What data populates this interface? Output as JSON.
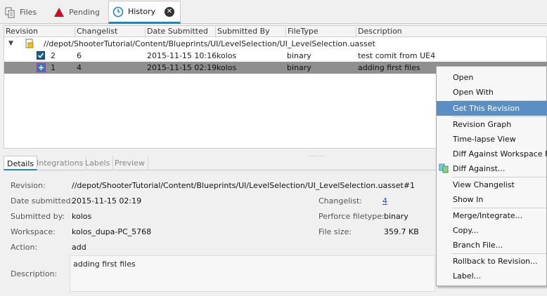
{
  "tabs": {
    "files": "Files",
    "pending": "Pending",
    "history": "History"
  },
  "grid": {
    "columns": [
      "Revision",
      "Changelist",
      "Date Submitted",
      "Submitted By",
      "FileType",
      "Description"
    ],
    "file_path": "//depot/ShooterTutorial/Content/Blueprints/UI/LevelSelection/UI_LevelSelection.uasset",
    "rows": [
      {
        "revision": "2",
        "changelist": "6",
        "date": "2015-11-15 10:16",
        "user": "kolos",
        "filetype": "binary",
        "description": "test comit from UE4"
      },
      {
        "revision": "1",
        "changelist": "4",
        "date": "2015-11-15 02:19",
        "user": "kolos",
        "filetype": "binary",
        "description": "adding first files"
      }
    ]
  },
  "lower_tabs": [
    "Details",
    "Integrations",
    "Labels",
    "Preview"
  ],
  "details": {
    "revision_label": "Revision:",
    "revision_value": "//depot/ShooterTutorial/Content/Blueprints/UI/LevelSelection/UI_LevelSelection.uasset#1",
    "date_label": "Date submitted:",
    "date_value": "2015-11-15 02:19",
    "submitted_label": "Submitted by:",
    "submitted_value": "kolos",
    "workspace_label": "Workspace:",
    "workspace_value": "kolos_dupa-PC_5768",
    "action_label": "Action:",
    "action_value": "add",
    "description_label": "Description:",
    "description_value": "adding first files",
    "changelist_label": "Changelist:",
    "changelist_value": "4",
    "filetype_label": "Perforce filetype:",
    "filetype_value": "binary",
    "filesize_label": "File size:",
    "filesize_value": "359.7 KB"
  },
  "context_menu": {
    "open": "Open",
    "open_with": "Open With",
    "get_revision": "Get This Revision",
    "revision_graph": "Revision Graph",
    "timelapse": "Time-lapse View",
    "diff_workspace": "Diff Against Workspace File",
    "diff_against": "Diff Against...",
    "view_changelist": "View Changelist",
    "show_in": "Show In",
    "merge": "Merge/Integrate...",
    "copy": "Copy...",
    "branch": "Branch File...",
    "rollback": "Rollback to Revision...",
    "label": "Label..."
  },
  "colors": {
    "accent": "#1a86c7",
    "selection": "#8f8f8f",
    "menu_highlight": "#5b8fc4",
    "link": "#1a4fb5"
  }
}
